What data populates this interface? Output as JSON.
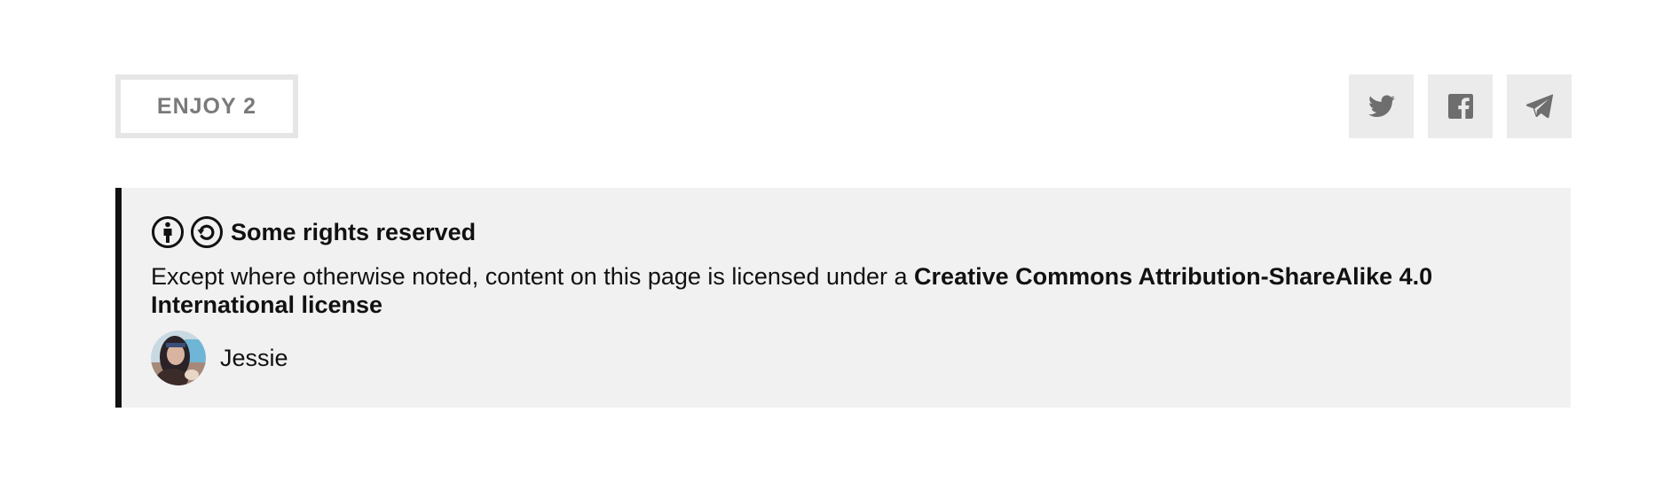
{
  "enjoy": {
    "label": "ENJOY 2"
  },
  "share": {
    "buttons": [
      {
        "icon": "twitter-icon"
      },
      {
        "icon": "facebook-icon"
      },
      {
        "icon": "telegram-icon"
      }
    ],
    "icon_color": "#6e6e6e",
    "background": "#ebebeb"
  },
  "license": {
    "title": "Some rights reserved",
    "text_prefix": "Except where otherwise noted, content on this page is licensed under a ",
    "license_name": "Creative Commons Attribution-ShareAlike 4.0 International license",
    "icons": [
      "cc-by-icon",
      "cc-sa-icon"
    ]
  },
  "author": {
    "name": "Jessie"
  },
  "colors": {
    "box_background": "#f1f1f1",
    "box_border": "#111111",
    "enjoy_border": "#e6e6e6",
    "enjoy_text": "#7a7a7a"
  }
}
